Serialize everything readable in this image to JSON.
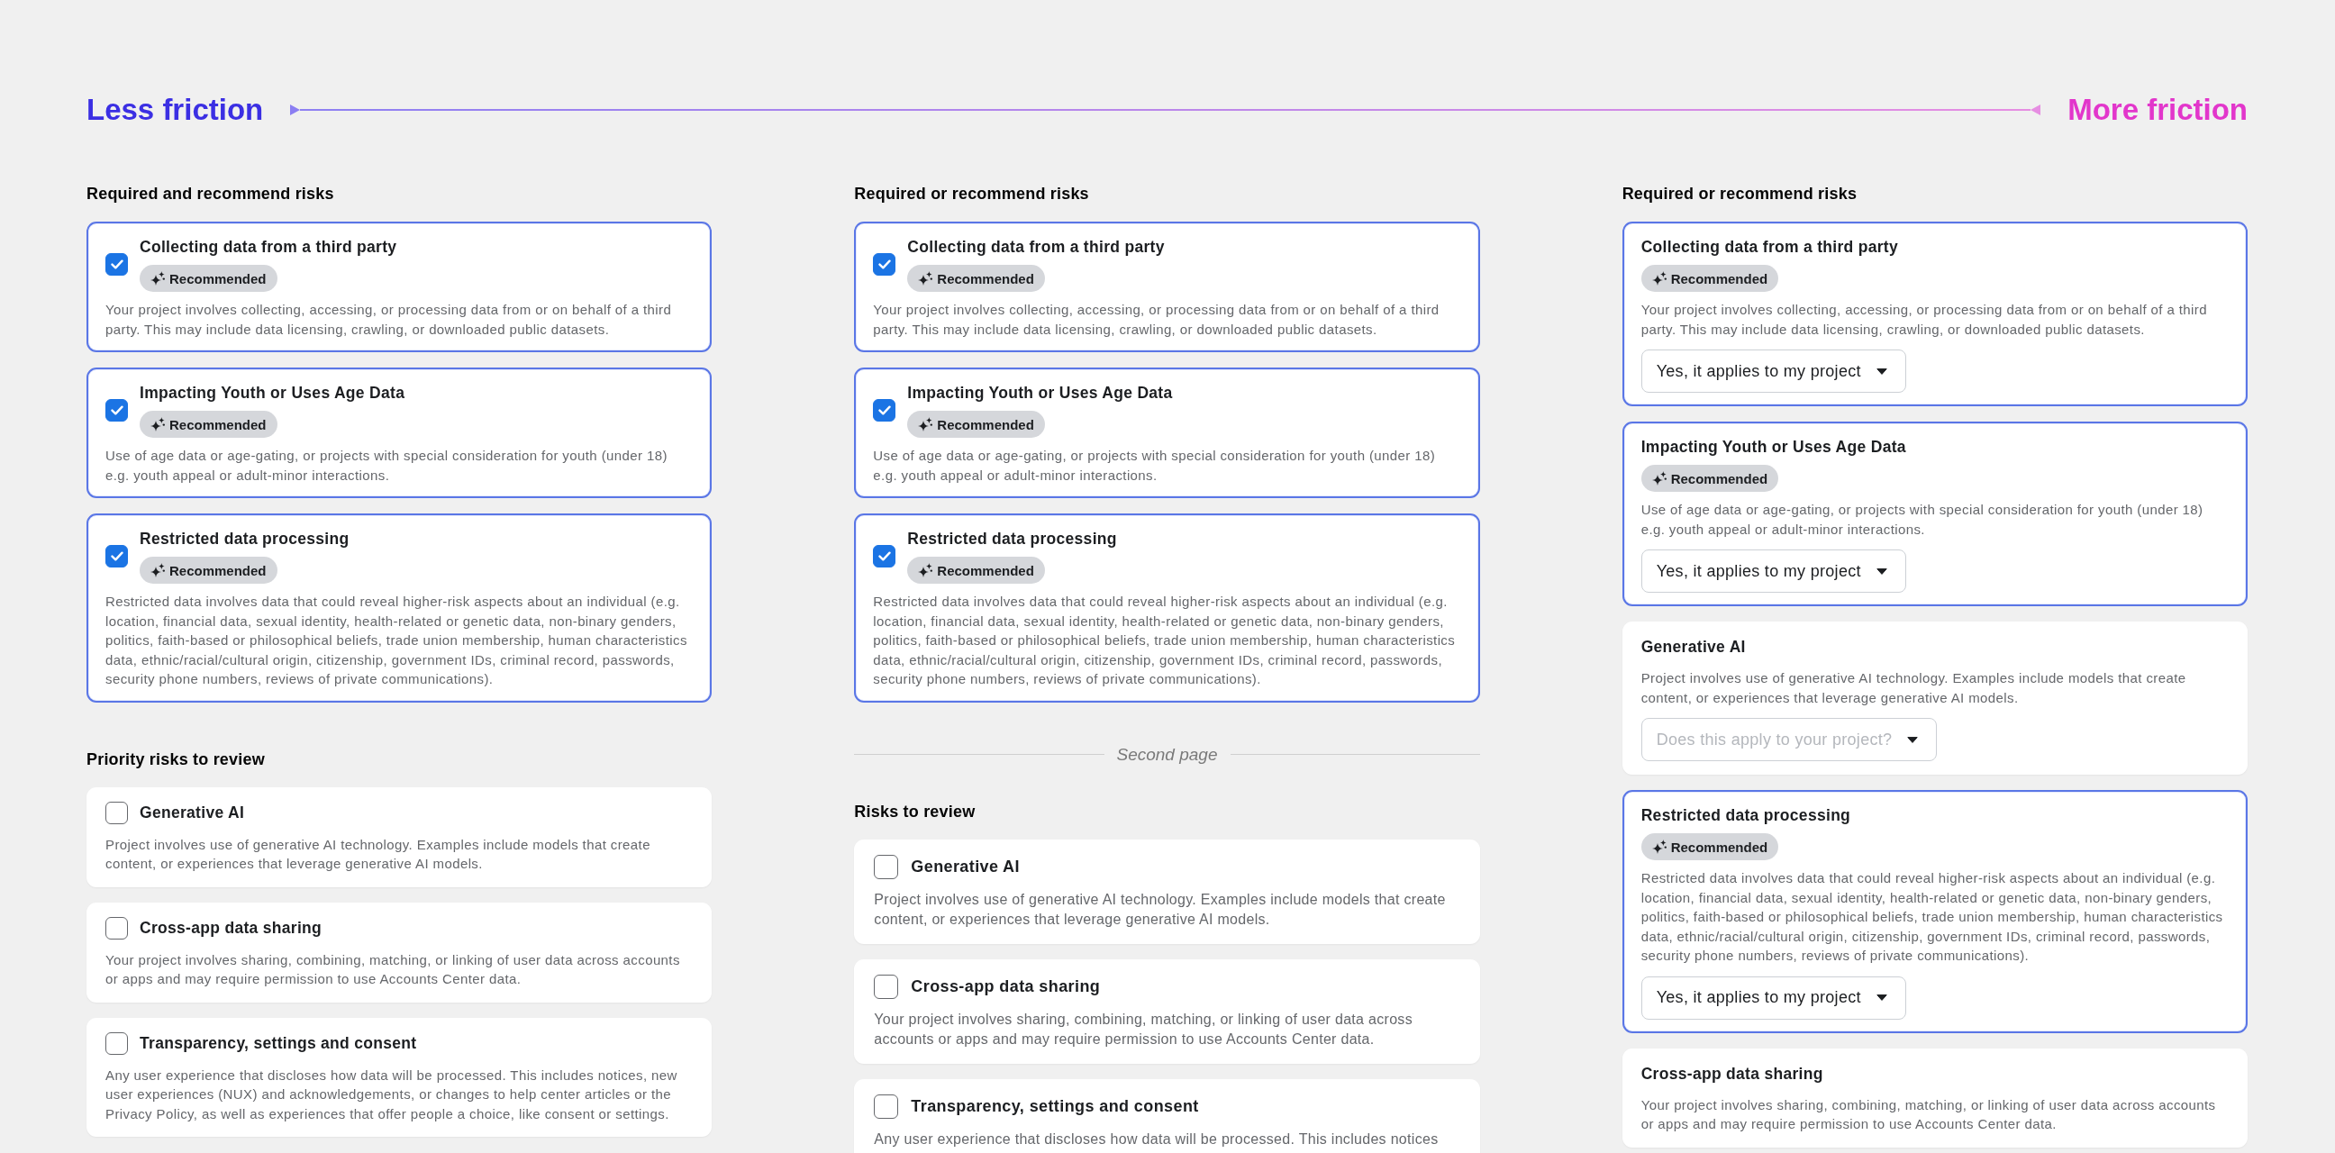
{
  "scale": {
    "start_label": "Less friction",
    "end_label": "More friction"
  },
  "columns": [
    {
      "sections": [
        {
          "kind": "group",
          "heading": "Required and recommend risks",
          "cards": [
            {
              "kind": "checkbox",
              "checked": true,
              "title": "Collecting data from a third party",
              "badge": "Recommended",
              "description": "Your project involves collecting, accessing, or processing data from or on behalf of a third party. This may include data licensing, crawling, or downloaded public datasets."
            },
            {
              "kind": "checkbox",
              "checked": true,
              "title": "Impacting Youth or Uses Age Data",
              "badge": "Recommended",
              "description": "Use of age data or age-gating, or projects with special consideration for youth (under 18) e.g. youth appeal or adult-minor interactions."
            },
            {
              "kind": "checkbox",
              "checked": true,
              "title": "Restricted data processing",
              "badge": "Recommended",
              "description": "Restricted data involves data that could reveal higher-risk aspects about an individual (e.g. location, financial data, sexual identity, health-related or genetic data, non-binary genders, politics, faith-based or philosophical beliefs, trade union membership, human characteristics data, ethnic/racial/cultural origin, citizenship, government IDs, criminal record, passwords, security phone numbers, reviews of private communications)."
            }
          ]
        },
        {
          "kind": "group",
          "heading": "Priority risks to review",
          "cards": [
            {
              "kind": "checkbox",
              "checked": false,
              "title": "Generative AI",
              "description": "Project involves use of generative AI technology. Examples include models that create content, or experiences that leverage generative AI models."
            },
            {
              "kind": "checkbox",
              "checked": false,
              "title": "Cross-app data sharing",
              "description": "Your project involves sharing, combining, matching, or linking of user data across accounts or apps and may require permission to use Accounts Center data."
            },
            {
              "kind": "checkbox",
              "checked": false,
              "title": "Transparency, settings and consent",
              "description": "Any user experience that discloses how data will be processed. This includes notices, new user experiences (NUX) and acknowledgements, or changes to help center articles or the Privacy Policy, as well as experiences that offer people a choice, like consent or settings."
            }
          ]
        }
      ]
    },
    {
      "sections": [
        {
          "kind": "group",
          "heading": "Required or recommend risks",
          "cards": [
            {
              "kind": "checkbox",
              "checked": true,
              "title": "Collecting data from a third party",
              "badge": "Recommended",
              "description": "Your project involves collecting, accessing, or processing data from or on behalf of a third party. This may include data licensing, crawling, or downloaded public datasets."
            },
            {
              "kind": "checkbox",
              "checked": true,
              "title": "Impacting Youth or Uses Age Data",
              "badge": "Recommended",
              "description": "Use of age data or age-gating, or projects with special consideration for youth (under 18) e.g. youth appeal or adult-minor interactions."
            },
            {
              "kind": "checkbox",
              "checked": true,
              "title": "Restricted data processing",
              "badge": "Recommended",
              "description": "Restricted data involves data that could reveal higher-risk aspects about an individual (e.g. location, financial data, sexual identity, health-related or genetic data, non-binary genders, politics, faith-based or philosophical beliefs, trade union membership, human characteristics data, ethnic/racial/cultural origin, citizenship, government IDs, criminal record, passwords, security phone numbers, reviews of private communications)."
            }
          ]
        },
        {
          "kind": "divider",
          "label": "Second page"
        },
        {
          "kind": "group",
          "heading": "Risks to review",
          "cards": [
            {
              "kind": "checkbox",
              "checked": false,
              "title": "Generative AI",
              "description": "Project involves use of generative AI technology. Examples include models that create content, or experiences that leverage generative AI models."
            },
            {
              "kind": "checkbox",
              "checked": false,
              "title": "Cross-app data sharing",
              "description": "Your project involves sharing, combining, matching, or linking of user data across accounts or apps and may require permission to use Accounts Center data."
            },
            {
              "kind": "checkbox",
              "checked": false,
              "title": "Transparency, settings and consent",
              "description": "Any user experience that discloses how data will be processed. This includes notices"
            }
          ]
        }
      ]
    },
    {
      "sections": [
        {
          "kind": "group",
          "heading": "Required or recommend risks",
          "cards": [
            {
              "kind": "dropdown",
              "title": "Collecting data from a third party",
              "badge": "Recommended",
              "description": "Your project involves collecting, accessing, or processing data from or on behalf of a third party. This may include data licensing, crawling, or downloaded public datasets.",
              "answer": {
                "value": "Yes, it applies to my project"
              }
            },
            {
              "kind": "dropdown",
              "title": "Impacting Youth or Uses Age Data",
              "badge": "Recommended",
              "description": "Use of age data or age-gating, or projects with special consideration for youth (under 18) e.g. youth appeal or adult-minor interactions.",
              "answer": {
                "value": "Yes, it applies to my project"
              }
            },
            {
              "kind": "dropdown",
              "title": "Generative AI",
              "description": "Project involves use of generative AI technology. Examples include models that create content, or experiences that leverage generative AI models.",
              "answer": {
                "placeholder": "Does this apply to your project?"
              }
            },
            {
              "kind": "dropdown",
              "title": "Restricted data processing",
              "badge": "Recommended",
              "description": "Restricted data involves data that could reveal higher-risk aspects about an individual (e.g. location, financial data, sexual identity, health-related or genetic data, non-binary genders, politics, faith-based or philosophical beliefs, trade union membership, human characteristics data, ethnic/racial/cultural origin, citizenship, government IDs, criminal record, passwords, security phone numbers, reviews of private communications).",
              "answer": {
                "value": "Yes, it applies to my project"
              }
            },
            {
              "kind": "dropdown",
              "title": "Cross-app data sharing",
              "description": "Your project involves sharing, combining, matching, or linking of user data across accounts or apps and may require permission to use Accounts Center data."
            }
          ]
        }
      ]
    }
  ]
}
